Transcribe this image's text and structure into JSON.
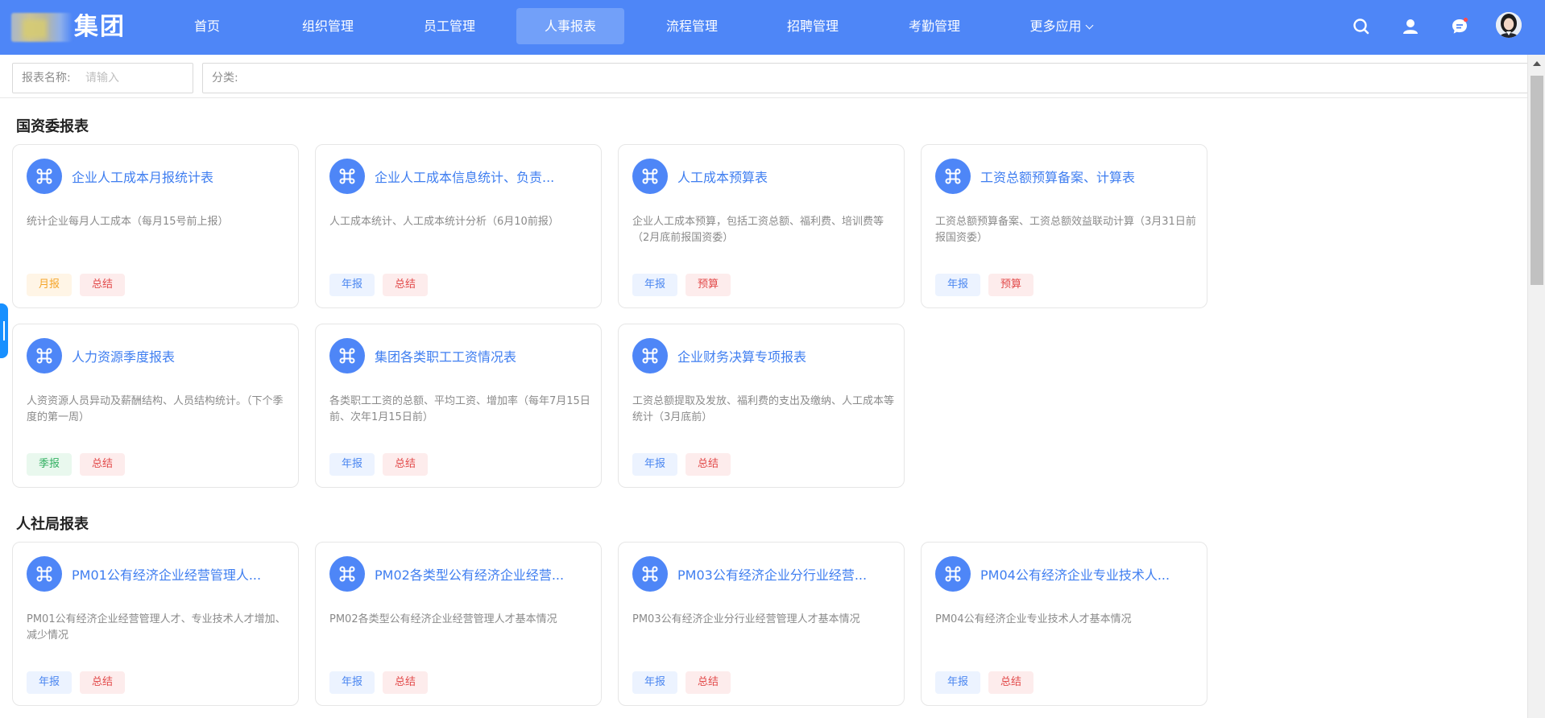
{
  "header": {
    "logo_text": "集团",
    "nav": [
      {
        "label": "首页"
      },
      {
        "label": "组织管理"
      },
      {
        "label": "员工管理"
      },
      {
        "label": "人事报表",
        "active": true
      },
      {
        "label": "流程管理"
      },
      {
        "label": "招聘管理"
      },
      {
        "label": "考勤管理"
      },
      {
        "label": "更多应用",
        "has_dropdown": true
      }
    ],
    "icons": [
      "search-icon",
      "user-icon",
      "message-icon",
      "avatar"
    ],
    "colors": {
      "bar": "#4e86f7",
      "active_tab": "#72a0f9",
      "notification_dot": "#ff4d4f"
    }
  },
  "filters": {
    "name": {
      "label": "报表名称:",
      "placeholder": "请输入",
      "value": ""
    },
    "category": {
      "label": "分类:",
      "value": ""
    }
  },
  "sections": [
    {
      "title": "国资委报表",
      "cards": [
        {
          "title": "企业人工成本月报统计表",
          "desc": "统计企业每月人工成本（每月15号前上报）",
          "tags": [
            {
              "label": "月报",
              "color": "orange"
            },
            {
              "label": "总结",
              "color": "red"
            }
          ]
        },
        {
          "title": "企业人工成本信息统计、负责...",
          "desc": "人工成本统计、人工成本统计分析（6月10前报）",
          "tags": [
            {
              "label": "年报",
              "color": "blue"
            },
            {
              "label": "总结",
              "color": "red"
            }
          ]
        },
        {
          "title": "人工成本预算表",
          "desc": "企业人工成本预算，包括工资总额、福利费、培训费等（2月底前报国资委）",
          "tags": [
            {
              "label": "年报",
              "color": "blue"
            },
            {
              "label": "预算",
              "color": "red"
            }
          ]
        },
        {
          "title": "工资总额预算备案、计算表",
          "desc": "工资总额预算备案、工资总额效益联动计算（3月31日前报国资委）",
          "tags": [
            {
              "label": "年报",
              "color": "blue"
            },
            {
              "label": "预算",
              "color": "red"
            }
          ]
        },
        {
          "title": "人力资源季度报表",
          "desc": "人资资源人员异动及薪酬结构、人员结构统计。（下个季度的第一周）",
          "tags": [
            {
              "label": "季报",
              "color": "green"
            },
            {
              "label": "总结",
              "color": "red"
            }
          ]
        },
        {
          "title": "集团各类职工工资情况表",
          "desc": "各类职工工资的总额、平均工资、增加率（每年7月15日前、次年1月15日前）",
          "tags": [
            {
              "label": "年报",
              "color": "blue"
            },
            {
              "label": "总结",
              "color": "red"
            }
          ]
        },
        {
          "title": "企业财务决算专项报表",
          "desc": "工资总额提取及发放、福利费的支出及缴纳、人工成本等统计（3月底前）",
          "tags": [
            {
              "label": "年报",
              "color": "blue"
            },
            {
              "label": "总结",
              "color": "red"
            }
          ]
        }
      ]
    },
    {
      "title": "人社局报表",
      "cards": [
        {
          "title": "PM01公有经济企业经营管理人...",
          "desc": "PM01公有经济企业经营管理人才、专业技术人才增加、减少情况",
          "tags": [
            {
              "label": "年报",
              "color": "blue"
            },
            {
              "label": "总结",
              "color": "red"
            }
          ]
        },
        {
          "title": "PM02各类型公有经济企业经营...",
          "desc": "PM02各类型公有经济企业经营管理人才基本情况",
          "tags": [
            {
              "label": "年报",
              "color": "blue"
            },
            {
              "label": "总结",
              "color": "red"
            }
          ]
        },
        {
          "title": "PM03公有经济企业分行业经营...",
          "desc": "PM03公有经济企业分行业经营管理人才基本情况",
          "tags": [
            {
              "label": "年报",
              "color": "blue"
            },
            {
              "label": "总结",
              "color": "red"
            }
          ]
        },
        {
          "title": "PM04公有经济企业专业技术人...",
          "desc": "PM04公有经济企业专业技术人才基本情况",
          "tags": [
            {
              "label": "年报",
              "color": "blue"
            },
            {
              "label": "总结",
              "color": "red"
            }
          ]
        }
      ]
    }
  ]
}
